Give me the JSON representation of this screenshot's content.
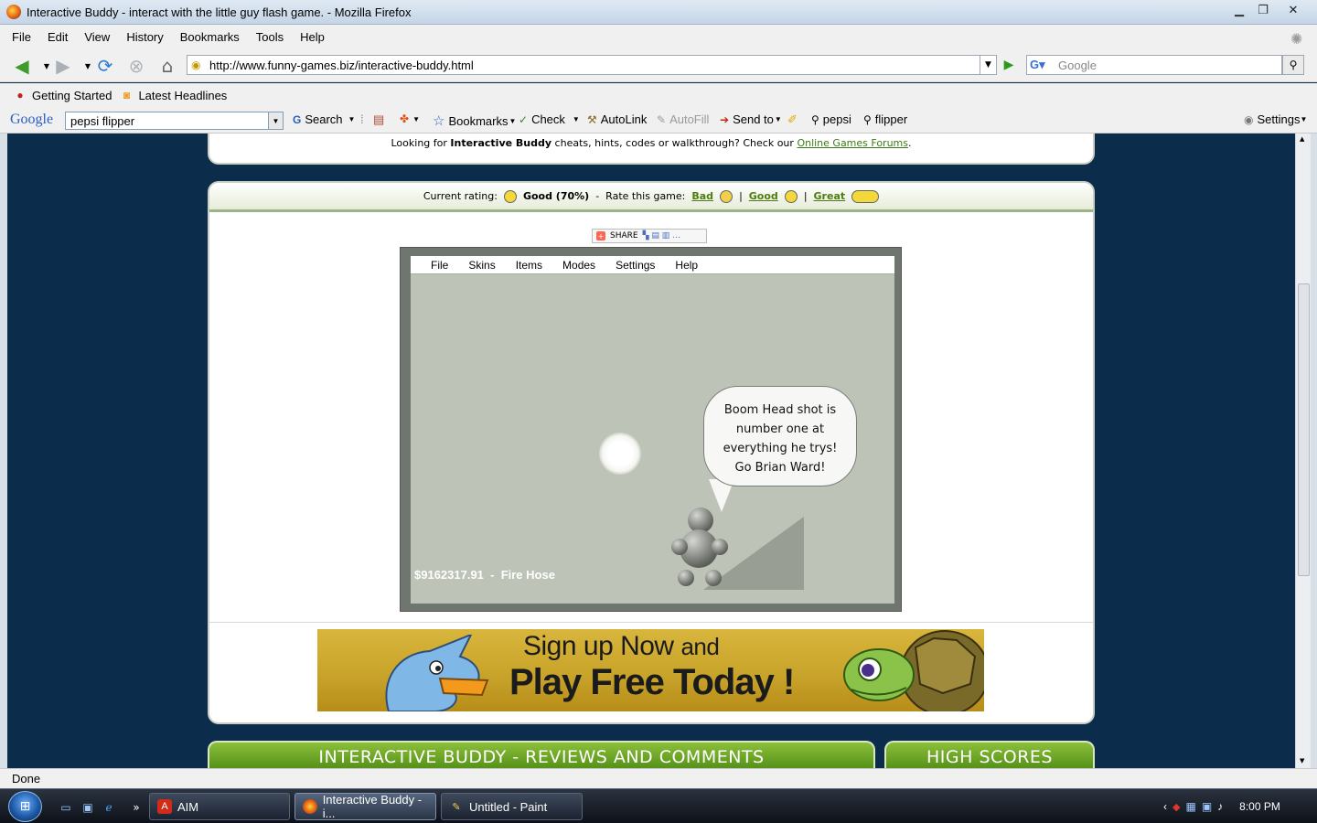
{
  "window": {
    "title": "Interactive Buddy - interact with the little guy flash game. - Mozilla Firefox"
  },
  "menubar": [
    "File",
    "Edit",
    "View",
    "History",
    "Bookmarks",
    "Tools",
    "Help"
  ],
  "navbar": {
    "url": "http://www.funny-games.biz/interactive-buddy.html",
    "search_placeholder": "Google"
  },
  "bookmarks": [
    "Getting Started",
    "Latest Headlines"
  ],
  "google_toolbar": {
    "logo": "Google",
    "query": "pepsi flipper",
    "search_label": "Search",
    "bookmarks_label": "Bookmarks",
    "check_label": "Check",
    "autolink_label": "AutoLink",
    "autofill_label": "AutoFill",
    "sendto_label": "Send to",
    "term1": "pepsi",
    "term2": "flipper",
    "settings_label": "Settings"
  },
  "page": {
    "forum_text_pre": "Looking for",
    "forum_bold": "Interactive Buddy",
    "forum_text_post": "cheats, hints, codes or walkthrough? Check our",
    "forum_link": "Online Games Forums",
    "forum_end": ".",
    "rating": {
      "current_label": "Current rating:",
      "current_value": "Good (70%)",
      "dash": "-",
      "rate_label": "Rate this game:",
      "bad": "Bad",
      "sep": "|",
      "good": "Good",
      "great": "Great"
    },
    "share_label": "SHARE",
    "game": {
      "menu": [
        "File",
        "Skins",
        "Items",
        "Modes",
        "Settings",
        "Help"
      ],
      "speech": [
        "Boom Head shot is",
        "number one at",
        "everything he trys!",
        "Go Brian Ward!"
      ],
      "status": "$9162317.91  -  Fire Hose"
    },
    "banner": {
      "line1_a": "Sign up Now",
      "line1_b": "and",
      "line2": "Play Free Today !"
    },
    "section_reviews": "INTERACTIVE BUDDY - REVIEWS AND COMMENTS",
    "section_scores": "HIGH SCORES"
  },
  "statusbar": {
    "text": "Done"
  },
  "taskbar": {
    "tasks": [
      "AIM",
      "Interactive Buddy - i...",
      "Untitled - Paint"
    ],
    "clock": "8:00 PM"
  },
  "colors": {
    "page_bg": "#0c2c4c",
    "link_green": "#4f7c12",
    "header_green": "#5f9a1e"
  }
}
